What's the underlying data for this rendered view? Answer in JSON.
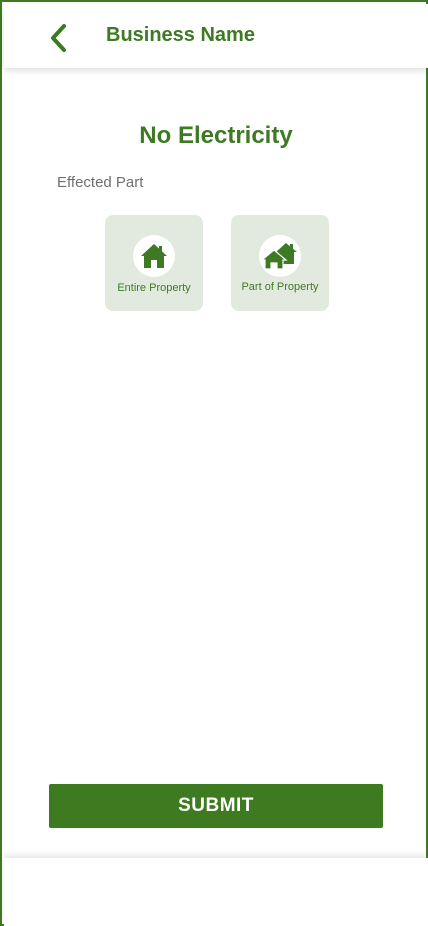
{
  "header": {
    "title": "Business Name",
    "back_icon": "chevron-left-icon"
  },
  "page": {
    "title": "No Electricity",
    "section_label": "Effected Part"
  },
  "options": [
    {
      "label": "Entire Property",
      "icon": "house-icon"
    },
    {
      "label": "Part of Property",
      "icon": "houses-icon"
    }
  ],
  "submit": {
    "label": "SUBMIT"
  },
  "colors": {
    "brand_green": "#3e7a24",
    "card_bg": "#e2eadf",
    "label_gray": "#6f6f6f"
  }
}
